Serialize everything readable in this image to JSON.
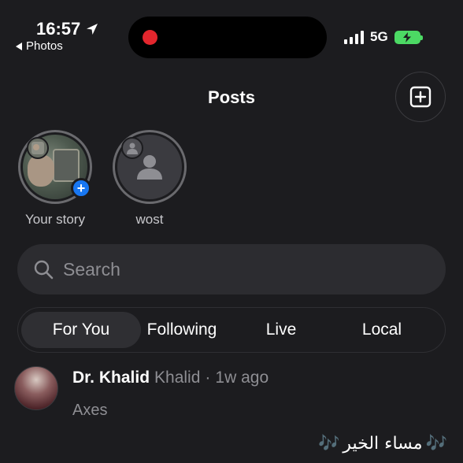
{
  "status_bar": {
    "time": "16:57",
    "back_label": "Photos",
    "network": "5G"
  },
  "header": {
    "title": "Posts"
  },
  "stories": [
    {
      "label": "Your story"
    },
    {
      "label": "wost"
    }
  ],
  "search": {
    "placeholder": "Search"
  },
  "tabs": [
    {
      "label": "For You",
      "active": true
    },
    {
      "label": "Following",
      "active": false
    },
    {
      "label": "Live",
      "active": false
    },
    {
      "label": "Local",
      "active": false
    }
  ],
  "post": {
    "author": "Dr. Khalid",
    "handle": "Khalid",
    "separator": "·",
    "time": "1w ago",
    "text": "Axes"
  },
  "overlay_caption": {
    "text": "مساء الخير",
    "note_left": "🎶",
    "note_right": "🎶"
  },
  "colors": {
    "background": "#1c1c1f",
    "accent": "#1877f2",
    "battery": "#4cd964",
    "record": "#e3262d"
  }
}
